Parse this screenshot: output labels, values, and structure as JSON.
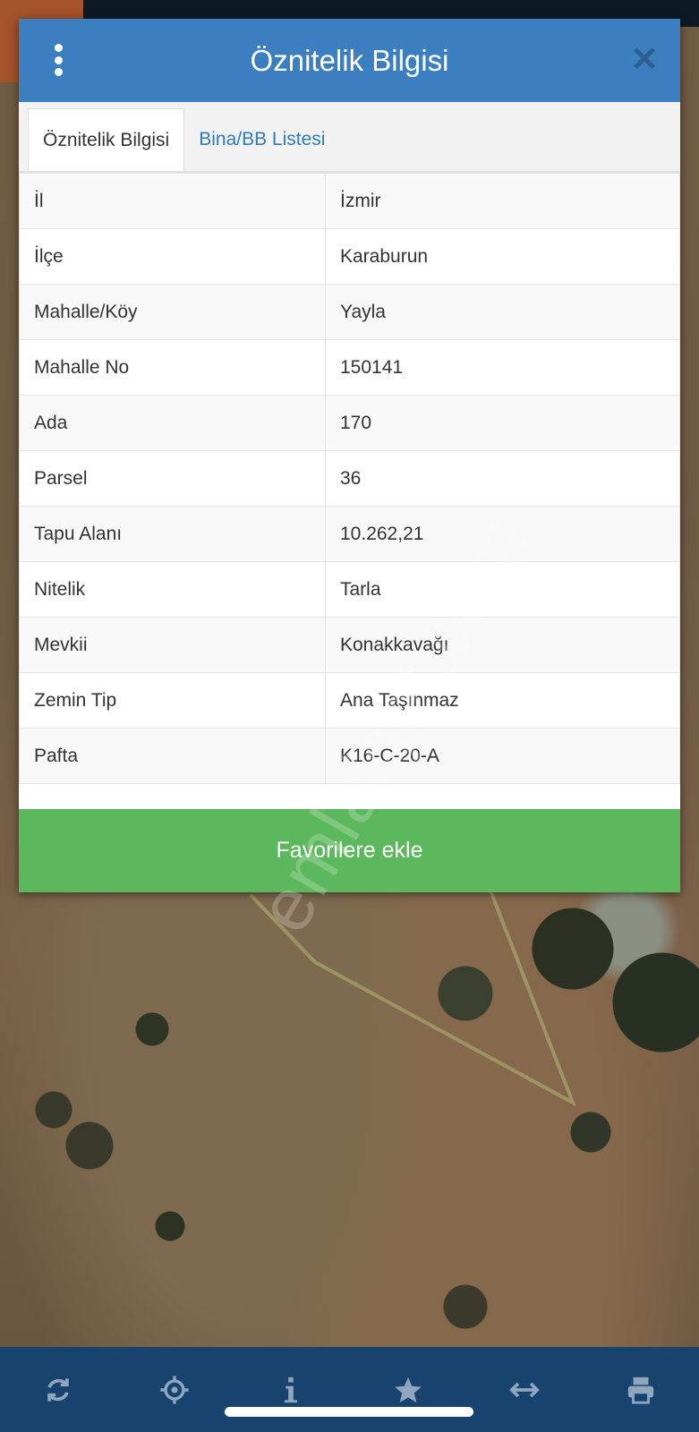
{
  "dialog": {
    "title": "Öznitelik Bilgisi",
    "tabs": [
      {
        "label": "Öznitelik Bilgisi",
        "active": true
      },
      {
        "label": "Bina/BB Listesi",
        "active": false
      }
    ],
    "rows": [
      {
        "key": "İl",
        "value": "İzmir"
      },
      {
        "key": "İlçe",
        "value": "Karaburun"
      },
      {
        "key": "Mahalle/Köy",
        "value": "Yayla"
      },
      {
        "key": "Mahalle No",
        "value": "150141"
      },
      {
        "key": "Ada",
        "value": "170"
      },
      {
        "key": "Parsel",
        "value": "36"
      },
      {
        "key": "Tapu Alanı",
        "value": "10.262,21"
      },
      {
        "key": "Nitelik",
        "value": "Tarla"
      },
      {
        "key": "Mevkii",
        "value": "Konakkavağı"
      },
      {
        "key": "Zemin Tip",
        "value": "Ana Taşınmaz"
      },
      {
        "key": "Pafta",
        "value": "K16-C-20-A"
      }
    ],
    "favorite_button": "Favorilere ekle"
  },
  "watermark": "emlakjet.com",
  "toolbar": {
    "icons": [
      "refresh-icon",
      "locate-icon",
      "info-icon",
      "star-icon",
      "measure-icon",
      "print-icon"
    ]
  },
  "colors": {
    "header": "#3b7fc1",
    "button": "#5cb85c",
    "toolbar": "#17436e",
    "toolbar_icon": "#8fa6bd"
  }
}
